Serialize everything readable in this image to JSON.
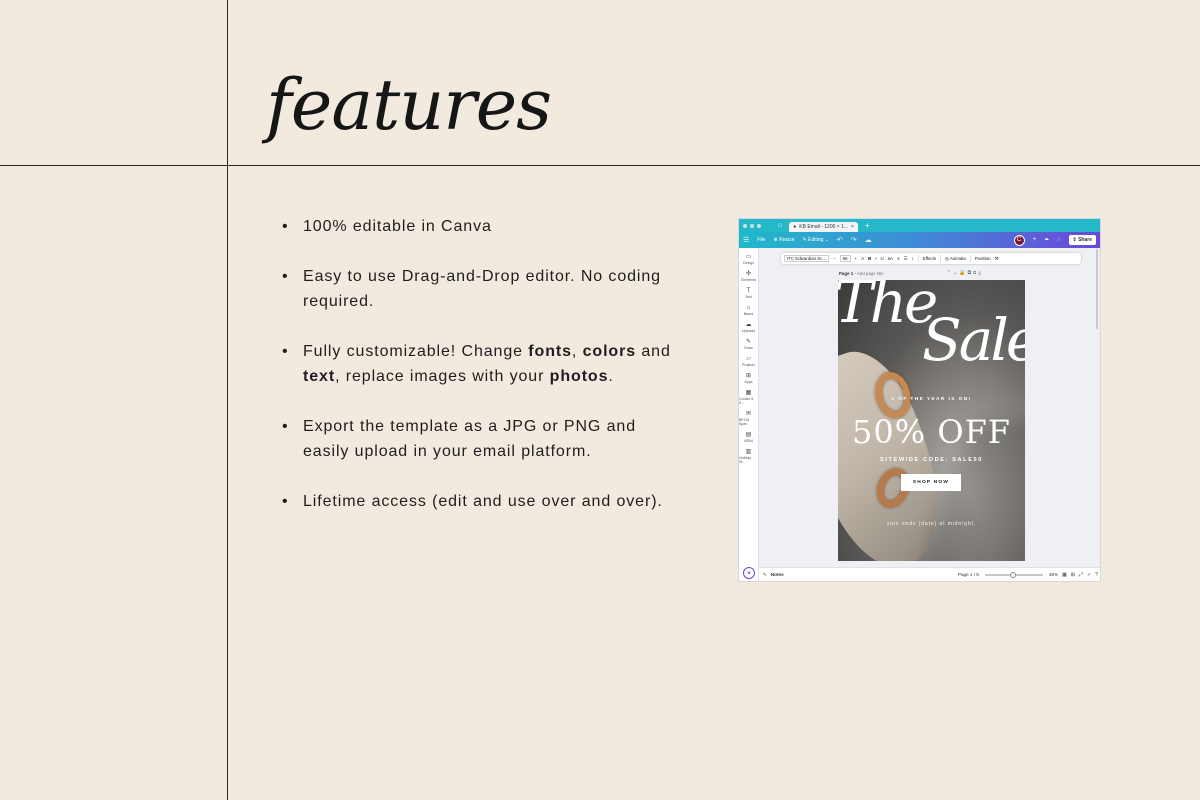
{
  "heading": "features",
  "features": [
    {
      "parts": [
        {
          "t": "100% editable in Canva",
          "b": false
        }
      ]
    },
    {
      "parts": [
        {
          "t": "Easy to use Drag-and-Drop editor. No coding required.",
          "b": false
        }
      ]
    },
    {
      "parts": [
        {
          "t": "Fully customizable! Change ",
          "b": false
        },
        {
          "t": "fonts",
          "b": true
        },
        {
          "t": ", ",
          "b": false
        },
        {
          "t": "colors",
          "b": true
        },
        {
          "t": " and ",
          "b": false
        },
        {
          "t": "text",
          "b": true
        },
        {
          "t": ", replace images with your ",
          "b": false
        },
        {
          "t": "photos",
          "b": true
        },
        {
          "t": ".",
          "b": false
        }
      ]
    },
    {
      "parts": [
        {
          "t": "Export the template as a JPG or PNG and easily upload in your email platform.",
          "b": false
        }
      ]
    },
    {
      "parts": [
        {
          "t": "Lifetime access (edit and use over and over).",
          "b": false
        }
      ]
    }
  ],
  "canva": {
    "tab_label": "KB Email - 1200 × 1...",
    "topbar": {
      "file": "File",
      "resize": "Resize",
      "editing": "Editing",
      "avatar": "C",
      "share": "Share"
    },
    "sidebar": [
      {
        "icon": "▭",
        "label": "Design"
      },
      {
        "icon": "✣",
        "label": "Elements"
      },
      {
        "icon": "T",
        "label": "Text"
      },
      {
        "icon": "⌂",
        "label": "Brand"
      },
      {
        "icon": "☁",
        "label": "Uploads"
      },
      {
        "icon": "✎",
        "label": "Draw"
      },
      {
        "icon": "▱",
        "label": "Projects"
      },
      {
        "icon": "⊞",
        "label": "Apps"
      },
      {
        "icon": "▦",
        "label": "Cookie & S..."
      },
      {
        "icon": "✉",
        "label": "BFCM Spar..."
      },
      {
        "icon": "▤",
        "label": "KB34"
      },
      {
        "icon": "▥",
        "label": "Holiday St..."
      }
    ],
    "toolbar": {
      "font": "ITC Edwardian Sc...",
      "size": "86",
      "effects": "Effects",
      "animate": "Animate",
      "position": "Position"
    },
    "page": {
      "label": "Page 1",
      "title_placeholder": "Add page title"
    },
    "design": {
      "title_line1": "The",
      "title_line2": "Sale",
      "subtitle": "1 OF THE YEAR IS ON!",
      "offer": "50% OFF",
      "code": "SITEWIDE CODE: SALE50",
      "button": "SHOP NOW",
      "end": "sale ends (date) at midnight."
    },
    "bottom": {
      "notes": "Notes",
      "page": "Page 1 / 5",
      "zoom": "48%"
    }
  }
}
